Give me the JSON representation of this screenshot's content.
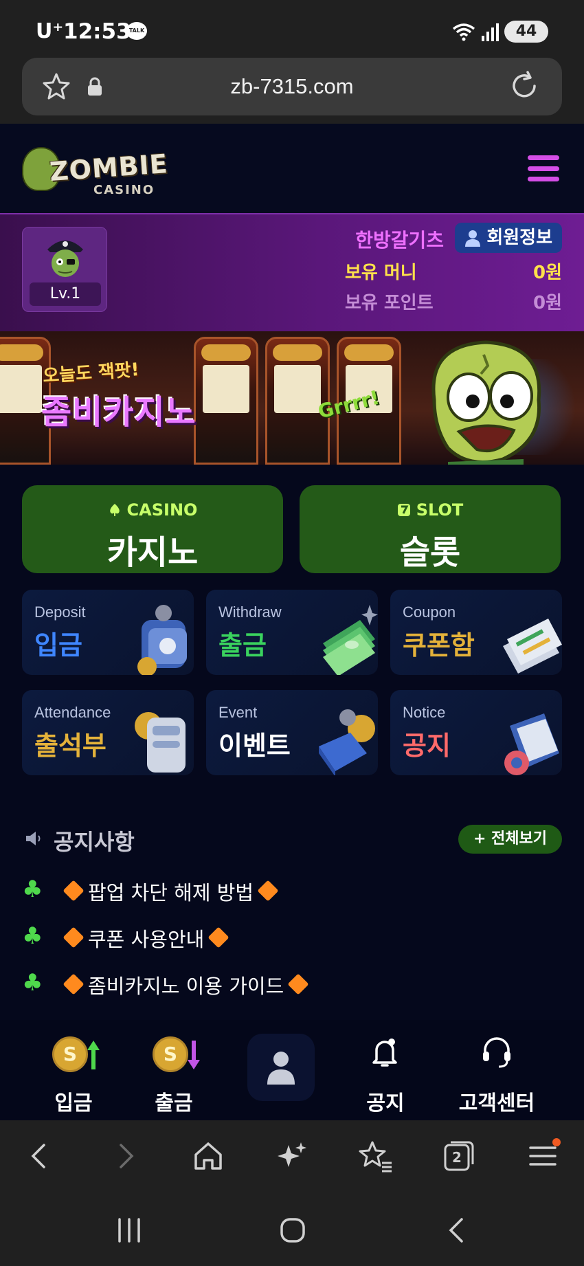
{
  "status_bar": {
    "carrier": "U⁺",
    "time": "12:53",
    "talk_badge": "TALK",
    "battery": "44"
  },
  "browser": {
    "url": "zb-7315.com",
    "tab_count": "2"
  },
  "site": {
    "logo_main": "ZOMBIE",
    "logo_sub": "CASINO"
  },
  "user": {
    "level": "Lv.1",
    "name": "한방갈기츠",
    "member_info_label": "회원정보",
    "money_label": "보유 머니",
    "money_value": "0원",
    "point_label": "보유 포인트",
    "point_value": "0원"
  },
  "banner": {
    "line1": "오늘도 잭팟!",
    "line2": "좀비카지노",
    "grr": "Grrrr!"
  },
  "games": [
    {
      "en": "CASINO",
      "ko": "카지노"
    },
    {
      "en": "SLOT",
      "ko": "슬롯"
    }
  ],
  "menu": [
    {
      "en": "Deposit",
      "ko": "입금",
      "color": "#3f86ff"
    },
    {
      "en": "Withdraw",
      "ko": "출금",
      "color": "#3ad35e"
    },
    {
      "en": "Coupon",
      "ko": "쿠폰함",
      "color": "#e4b23a"
    },
    {
      "en": "Attendance",
      "ko": "출석부",
      "color": "#e4b23a"
    },
    {
      "en": "Event",
      "ko": "이벤트",
      "color": "#ffffff"
    },
    {
      "en": "Notice",
      "ko": "공지",
      "color": "#ff6a6a"
    }
  ],
  "notice": {
    "title": "공지사항",
    "view_all": "+ 전체보기",
    "items": [
      "팝업 차단 해제 방법",
      "쿠폰 사용안내",
      "좀비카지노 이용 가이드"
    ]
  },
  "bottom_nav": {
    "deposit": "입금",
    "withdraw": "출금",
    "notice": "공지",
    "support": "고객센터",
    "coin_symbol": "S"
  },
  "colors": {
    "accent_purple": "#d44ee6",
    "green_button": "#245a18",
    "nav_bg": "#04071a"
  }
}
